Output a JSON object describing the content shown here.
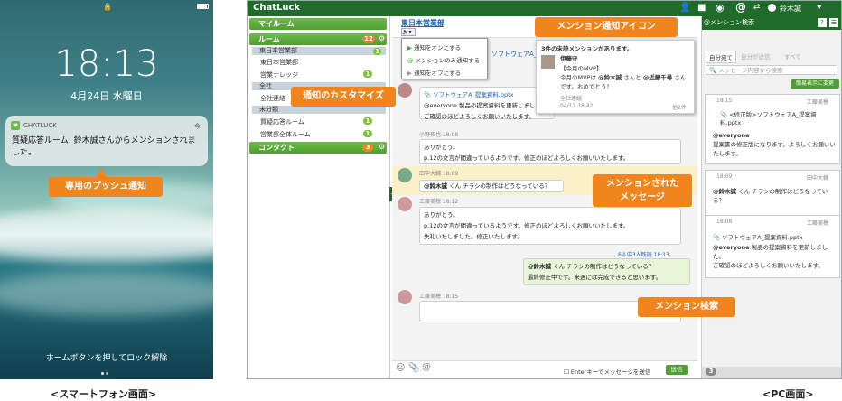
{
  "smartphone": {
    "time": "18:13",
    "date": "4月24日 水曜日",
    "unlock": "ホームボタンを押してロック解除",
    "caption": "<スマートフォン画面>",
    "notification": {
      "app": "CHATLUCK",
      "when": "今",
      "text": "質疑応答ルーム: 鈴木誠さんからメンションされました。"
    },
    "callout": "専用のプッシュ通知"
  },
  "pc": {
    "caption": "<PC画面>",
    "app_title": "ChatLuck",
    "user": "鈴木誠",
    "sidebar": {
      "myroom": "マイルーム",
      "room": "ルーム",
      "room_badge": "12",
      "contact": "コンタクト",
      "contact_badge": "3",
      "items": [
        {
          "label": "東日本営業部",
          "badge": "1"
        },
        {
          "label": "東日本営業部",
          "badge": ""
        },
        {
          "label": "営業ナレッジ",
          "badge": "1"
        },
        {
          "label": "全社",
          "badge": ""
        },
        {
          "label": "全社連絡",
          "badge": ""
        },
        {
          "label": "未分類",
          "badge": ""
        },
        {
          "label": "質疑応答ルーム",
          "badge": "1"
        },
        {
          "label": "営業部全体ルーム",
          "badge": "1"
        }
      ]
    },
    "chat": {
      "room_name": "東日本営業部",
      "menu": [
        "通知をオンにする",
        "メンションのみ通知する",
        "通知をオフにする"
      ],
      "file": "ソフトウェアA_提案資料.pptx",
      "messages": [
        {
          "sender": "",
          "text": "@everyone 製品の提案資料を更新しました。",
          "text2": "ご確認のほどよろしくお願いいたします。"
        },
        {
          "sender": "小野拓也 18:08",
          "text": "ありがとう。",
          "text2": "p.12の文言が間違っているようです。修正のほどよろしくお願いいたします。"
        },
        {
          "sender": "田中大輔 18:09",
          "mention": "@鈴木誠",
          "text": "くん チラシの制作はどうなっている？"
        },
        {
          "sender": "工藤美穂 18:12",
          "text": "ありがとう。",
          "text2": "p.12の文言が間違っているようです。修正のほどよろしくお願いいたします。",
          "text3": "失礼いたしました。修正いたします。"
        },
        {
          "sender": "6人中3人既読 18:13",
          "mention": "@鈴木誠",
          "text": "くん チラシの制作はどうなっている？",
          "text2": "最終修正中です。来週には完成できると思います。"
        },
        {
          "sender": "工藤美穂 18:15",
          "text": ""
        }
      ],
      "input_hint": "Enterキーでメッセージを送信",
      "send": "送信"
    },
    "mention_popup": {
      "header": "3件の未読メンションがあります。",
      "name": "伊藤守",
      "subject": "【今月のMVP】",
      "body1": "今月のMVPは",
      "m1": "@鈴木誠",
      "body2": "さんと",
      "m2": "@近藤千尋",
      "body3": "さんです。おめでとう！",
      "room": "全社連絡",
      "date": "04/17 18:42",
      "count": "他2件"
    },
    "right": {
      "title": "メンション検索",
      "tabs": [
        "自分宛て",
        "自分が送信",
        "すべて"
      ],
      "search_placeholder": "メッセージ内容から検索",
      "simple_btn": "簡易表示に変更",
      "footer_count": "3",
      "cards": [
        {
          "time": "18:15",
          "user": "工藤美穂",
          "file": "<修正版>ソフトウェアA_提案資料.pptx",
          "mention": "@everyone",
          "text": "提案書の修正版になります。よろしくお願いいたします。"
        },
        {
          "time": "18:09",
          "user": "田中大輔",
          "mention": "@鈴木誠",
          "text": "くん チラシの制作はどうなっている？"
        },
        {
          "time": "18:08",
          "user": "工藤美穂",
          "file": "ソフトウェアA_提案資料.pptx",
          "mention": "@everyone",
          "text": "製品の提案資料を更新しました。",
          "text2": "ご確認のほどよろしくお願いいたします。"
        }
      ]
    },
    "callouts": {
      "icon": "メンション通知アイコン",
      "custom": "通知のカスタマイズ",
      "mentioned_1": "メンションされた",
      "mentioned_2": "メッセージ",
      "search": "メンション検索"
    }
  },
  "colors": {
    "accent": "#f0851e",
    "green": "#1e6b2a",
    "badge": "#7cbf3a"
  }
}
